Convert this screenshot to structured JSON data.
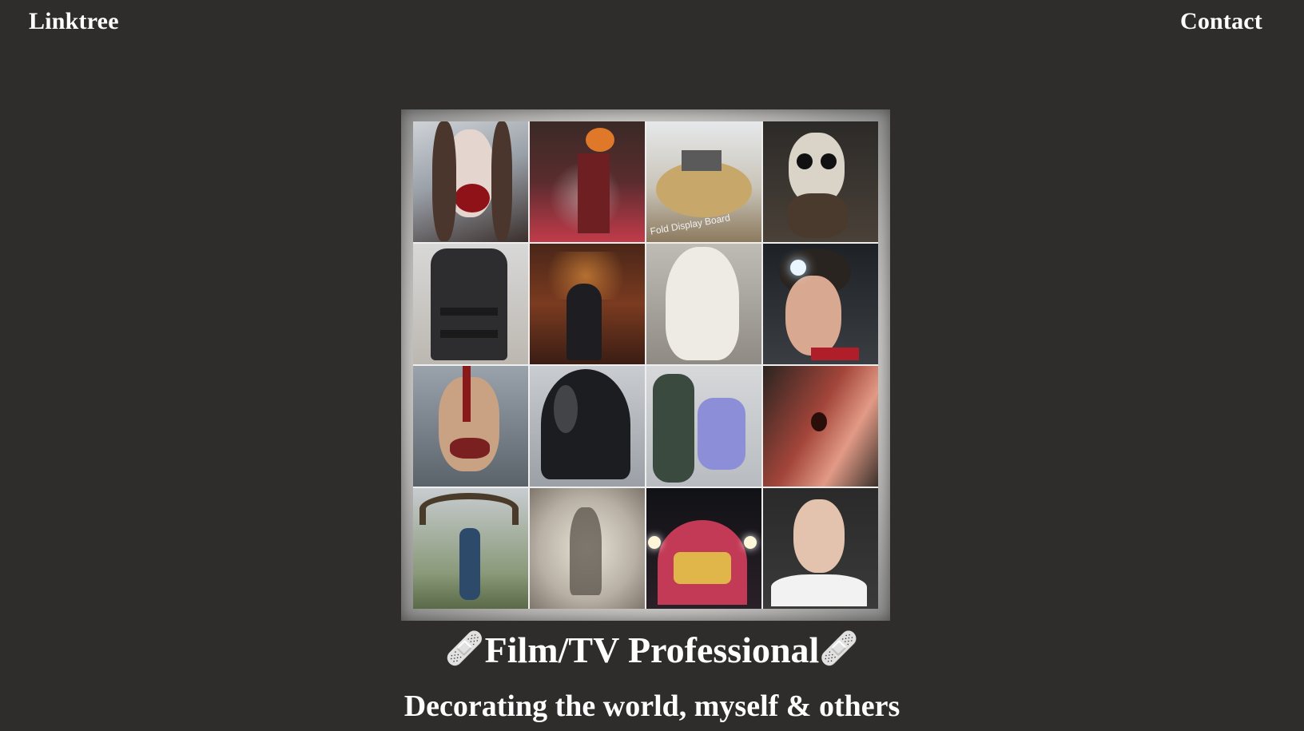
{
  "header": {
    "left_link": "Linktree",
    "right_link": "Contact"
  },
  "collage": {
    "tiles": [
      "zombie-girl-bloody-mouth",
      "pumpkin-scarecrow-halloween",
      "fold-display-board-model",
      "skull-face-paint-bearded-man",
      "black-armor-vest",
      "man-sitting-in-study",
      "plaster-bandaged-head",
      "elf-ear-makeup-girl",
      "rotting-zombie-mask",
      "darth-vader-helmet",
      "crime-scene-staging",
      "wound-prosthetic-closeup",
      "man-under-halloween-arch",
      "shadow-silhouette-figure",
      "carnival-booth-lights",
      "woman-headshot-portrait"
    ],
    "visible_text": [
      "Fold Display Board"
    ]
  },
  "profile": {
    "emoji": "🩹",
    "title": "Film/TV Professional",
    "subtitle": "Decorating the world, myself & others"
  }
}
